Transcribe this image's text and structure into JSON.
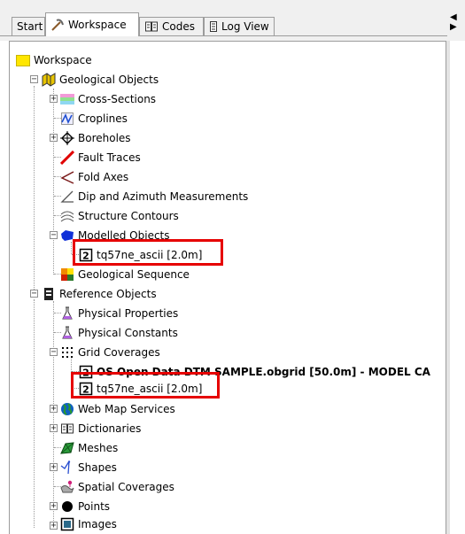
{
  "tabs": [
    {
      "label": "Start",
      "icon": ""
    },
    {
      "label": "Workspace",
      "icon": "pickaxe-icon"
    },
    {
      "label": "Codes",
      "icon": "book-icon"
    },
    {
      "label": "Log View",
      "icon": "log-icon"
    }
  ],
  "tree": {
    "root": "Workspace",
    "geological": {
      "label": "Geological Objects",
      "cross_sections": "Cross-Sections",
      "croplines": "Croplines",
      "boreholes": "Boreholes",
      "fault_traces": "Fault Traces",
      "fold_axes": "Fold Axes",
      "dip_azimuth": "Dip and Azimuth Measurements",
      "structure_contours": "Structure Contours",
      "modelled_objects": "Modelled Objects",
      "modelled_child": "tq57ne_ascii [2.0m]",
      "geological_sequence": "Geological Sequence"
    },
    "reference": {
      "label": "Reference Objects",
      "physical_properties": "Physical Properties",
      "physical_constants": "Physical Constants",
      "grid_coverages": "Grid Coverages",
      "grid_child_1": "OS Open Data DTM SAMPLE.obgrid [50.0m] - MODEL CA",
      "grid_child_2": "tq57ne_ascii [2.0m]",
      "web_map_services": "Web Map Services",
      "dictionaries": "Dictionaries",
      "meshes": "Meshes",
      "shapes": "Shapes",
      "spatial_coverages": "Spatial Coverages",
      "points": "Points",
      "images": "Images"
    }
  },
  "colors": {
    "highlight": "#e60000",
    "folder": "#ffe600",
    "fault_trace": "#e00000"
  }
}
